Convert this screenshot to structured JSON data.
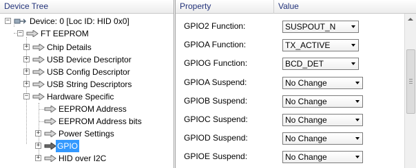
{
  "tree": {
    "header": "Device Tree",
    "nodes": {
      "device": "Device: 0 [Loc ID: HID 0x0]",
      "ft_eeprom": "FT EEPROM",
      "chip_details": "Chip Details",
      "usb_device_descriptor": "USB Device Descriptor",
      "usb_config_descriptor": "USB Config Descriptor",
      "usb_string_descriptors": "USB String Descriptors",
      "hardware_specific": "Hardware Specific",
      "eeprom_address": "EEPROM Address",
      "eeprom_address_bits": "EEPROM Address bits",
      "power_settings": "Power Settings",
      "gpio": "GPIO",
      "hid_over_i2c": "HID over I2C"
    },
    "selected": "gpio"
  },
  "properties": {
    "header_property": "Property",
    "header_value": "Value",
    "rows": [
      {
        "name": "GPIO2 Function:",
        "value": "SUSPOUT_N"
      },
      {
        "name": "GPIOA Function:",
        "value": "TX_ACTIVE"
      },
      {
        "name": "GPIOG Function:",
        "value": "BCD_DET"
      },
      {
        "name": "GPIOA Suspend:",
        "value": "No Change"
      },
      {
        "name": "GPIOB Suspend:",
        "value": "No Change"
      },
      {
        "name": "GPIOC Suspend:",
        "value": "No Change"
      },
      {
        "name": "GPIOD Suspend:",
        "value": "No Change"
      },
      {
        "name": "GPIOE Suspend:",
        "value": "No Change"
      }
    ]
  },
  "colors": {
    "selection": "#3399ff",
    "header_text": "#22327a"
  }
}
